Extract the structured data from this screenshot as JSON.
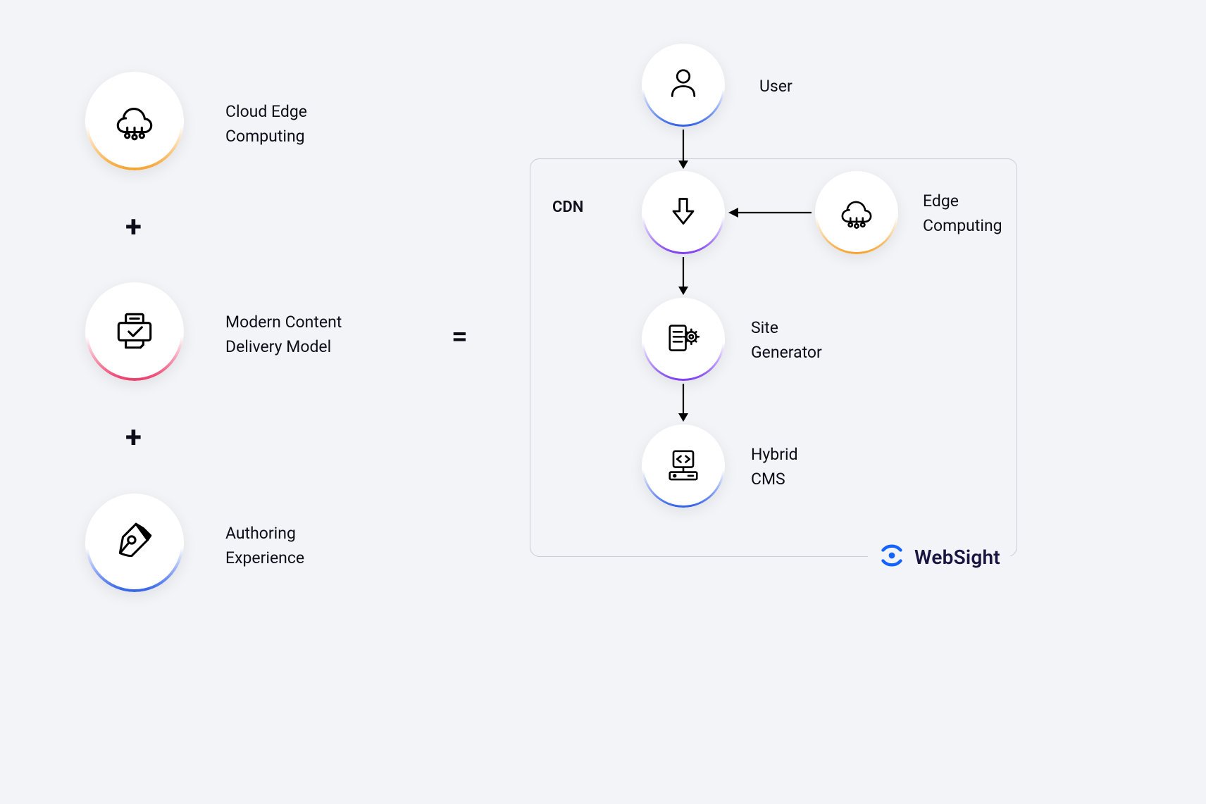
{
  "left": {
    "items": [
      {
        "label": "Cloud Edge\nComputing",
        "icon": "edge-cloud",
        "ring": "orange"
      },
      {
        "label": "Modern Content\nDelivery Model",
        "icon": "printer-check",
        "ring": "pink"
      },
      {
        "label": "Authoring\nExperience",
        "icon": "pen-nib",
        "ring": "blue"
      }
    ],
    "operator": "+"
  },
  "center": {
    "operator": "="
  },
  "right": {
    "box_label": "CDN",
    "nodes": {
      "user": {
        "label": "User",
        "icon": "user",
        "ring": "blue"
      },
      "cdn": {
        "label": "CDN",
        "icon": "download-arrow",
        "ring": "purple"
      },
      "edge": {
        "label": "Edge\nComputing",
        "icon": "edge-cloud",
        "ring": "orange"
      },
      "generator": {
        "label": "Site\nGenerator",
        "icon": "site-gear",
        "ring": "purple"
      },
      "cms": {
        "label": "Hybrid\nCMS",
        "icon": "code-monitor",
        "ring": "blue"
      }
    },
    "brand": "WebSight"
  }
}
